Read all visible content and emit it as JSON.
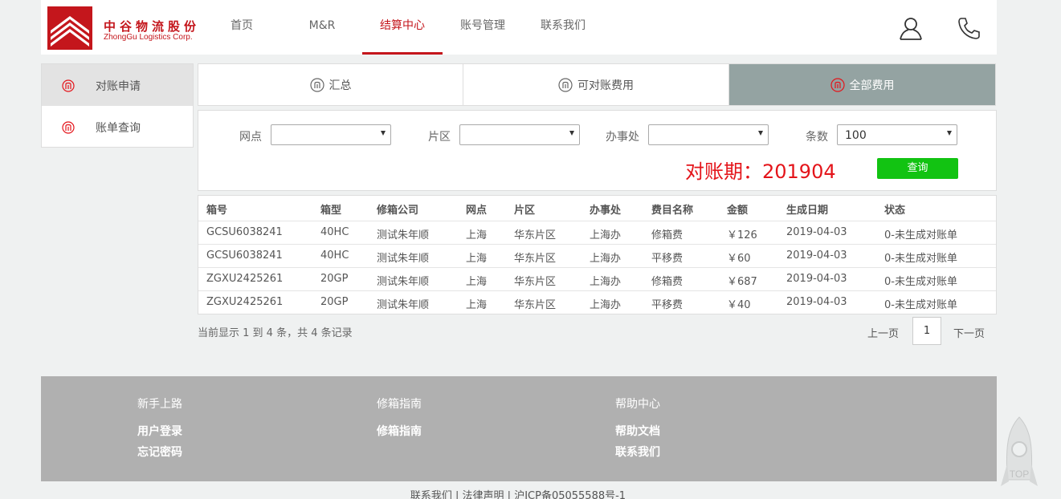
{
  "logo": {
    "cn": "中谷物流股份",
    "en": "ZhongGu Logistics Corp."
  },
  "nav": [
    {
      "label": "首页",
      "active": false
    },
    {
      "label": "M&R",
      "active": false
    },
    {
      "label": "结算中心",
      "active": true
    },
    {
      "label": "账号管理",
      "active": false
    },
    {
      "label": "联系我们",
      "active": false
    }
  ],
  "header_icons": [
    "user-icon",
    "phone-icon"
  ],
  "sidebar": {
    "items": [
      {
        "label": "对账申请",
        "active": true
      },
      {
        "label": "账单查询",
        "active": false
      }
    ]
  },
  "tabs": [
    {
      "label": "汇总",
      "active": false
    },
    {
      "label": "可对账费用",
      "active": false
    },
    {
      "label": "全部费用",
      "active": true
    }
  ],
  "filter": {
    "site_label": "网点",
    "site_value": "",
    "area_label": "片区",
    "area_value": "",
    "office_label": "办事处",
    "office_value": "",
    "count_label": "条数",
    "count_value": "100",
    "period": "对账期：201904",
    "query_label": "查询"
  },
  "table": {
    "columns": [
      "箱号",
      "箱型",
      "修箱公司",
      "网点",
      "片区",
      "办事处",
      "费目名称",
      "金额",
      "生成日期",
      "状态"
    ],
    "rows": [
      [
        "GCSU6038241",
        "40HC",
        "测试朱年顺",
        "上海",
        "华东片区",
        "上海办",
        "修箱费",
        "￥126",
        "2019-04-03",
        "0-未生成对账单"
      ],
      [
        "GCSU6038241",
        "40HC",
        "测试朱年顺",
        "上海",
        "华东片区",
        "上海办",
        "平移费",
        "￥60",
        "2019-04-03",
        "0-未生成对账单"
      ],
      [
        "ZGXU2425261",
        "20GP",
        "测试朱年顺",
        "上海",
        "华东片区",
        "上海办",
        "修箱费",
        "￥687",
        "2019-04-03",
        "0-未生成对账单"
      ],
      [
        "ZGXU2425261",
        "20GP",
        "测试朱年顺",
        "上海",
        "华东片区",
        "上海办",
        "平移费",
        "￥40",
        "2019-04-03",
        "0-未生成对账单"
      ]
    ]
  },
  "pagination": {
    "summary": "当前显示 1 到 4 条，共 4 条记录",
    "prev": "上一页",
    "current": "1",
    "next": "下一页"
  },
  "footer": {
    "columns": [
      {
        "title": "新手上路",
        "links": [
          "用户登录",
          "忘记密码"
        ]
      },
      {
        "title": "修箱指南",
        "links": [
          "修箱指南"
        ]
      },
      {
        "title": "帮助中心",
        "links": [
          "帮助文档",
          "联系我们"
        ]
      }
    ],
    "copyright": "联系我们 | 法律声明 | 沪ICP备05055588号-1"
  },
  "top_button": {
    "label": "TOP"
  },
  "colors": {
    "brand": "#c4161c",
    "active_tab": "#94a3a2",
    "query_button": "#12c312",
    "period": "#e4141a"
  }
}
